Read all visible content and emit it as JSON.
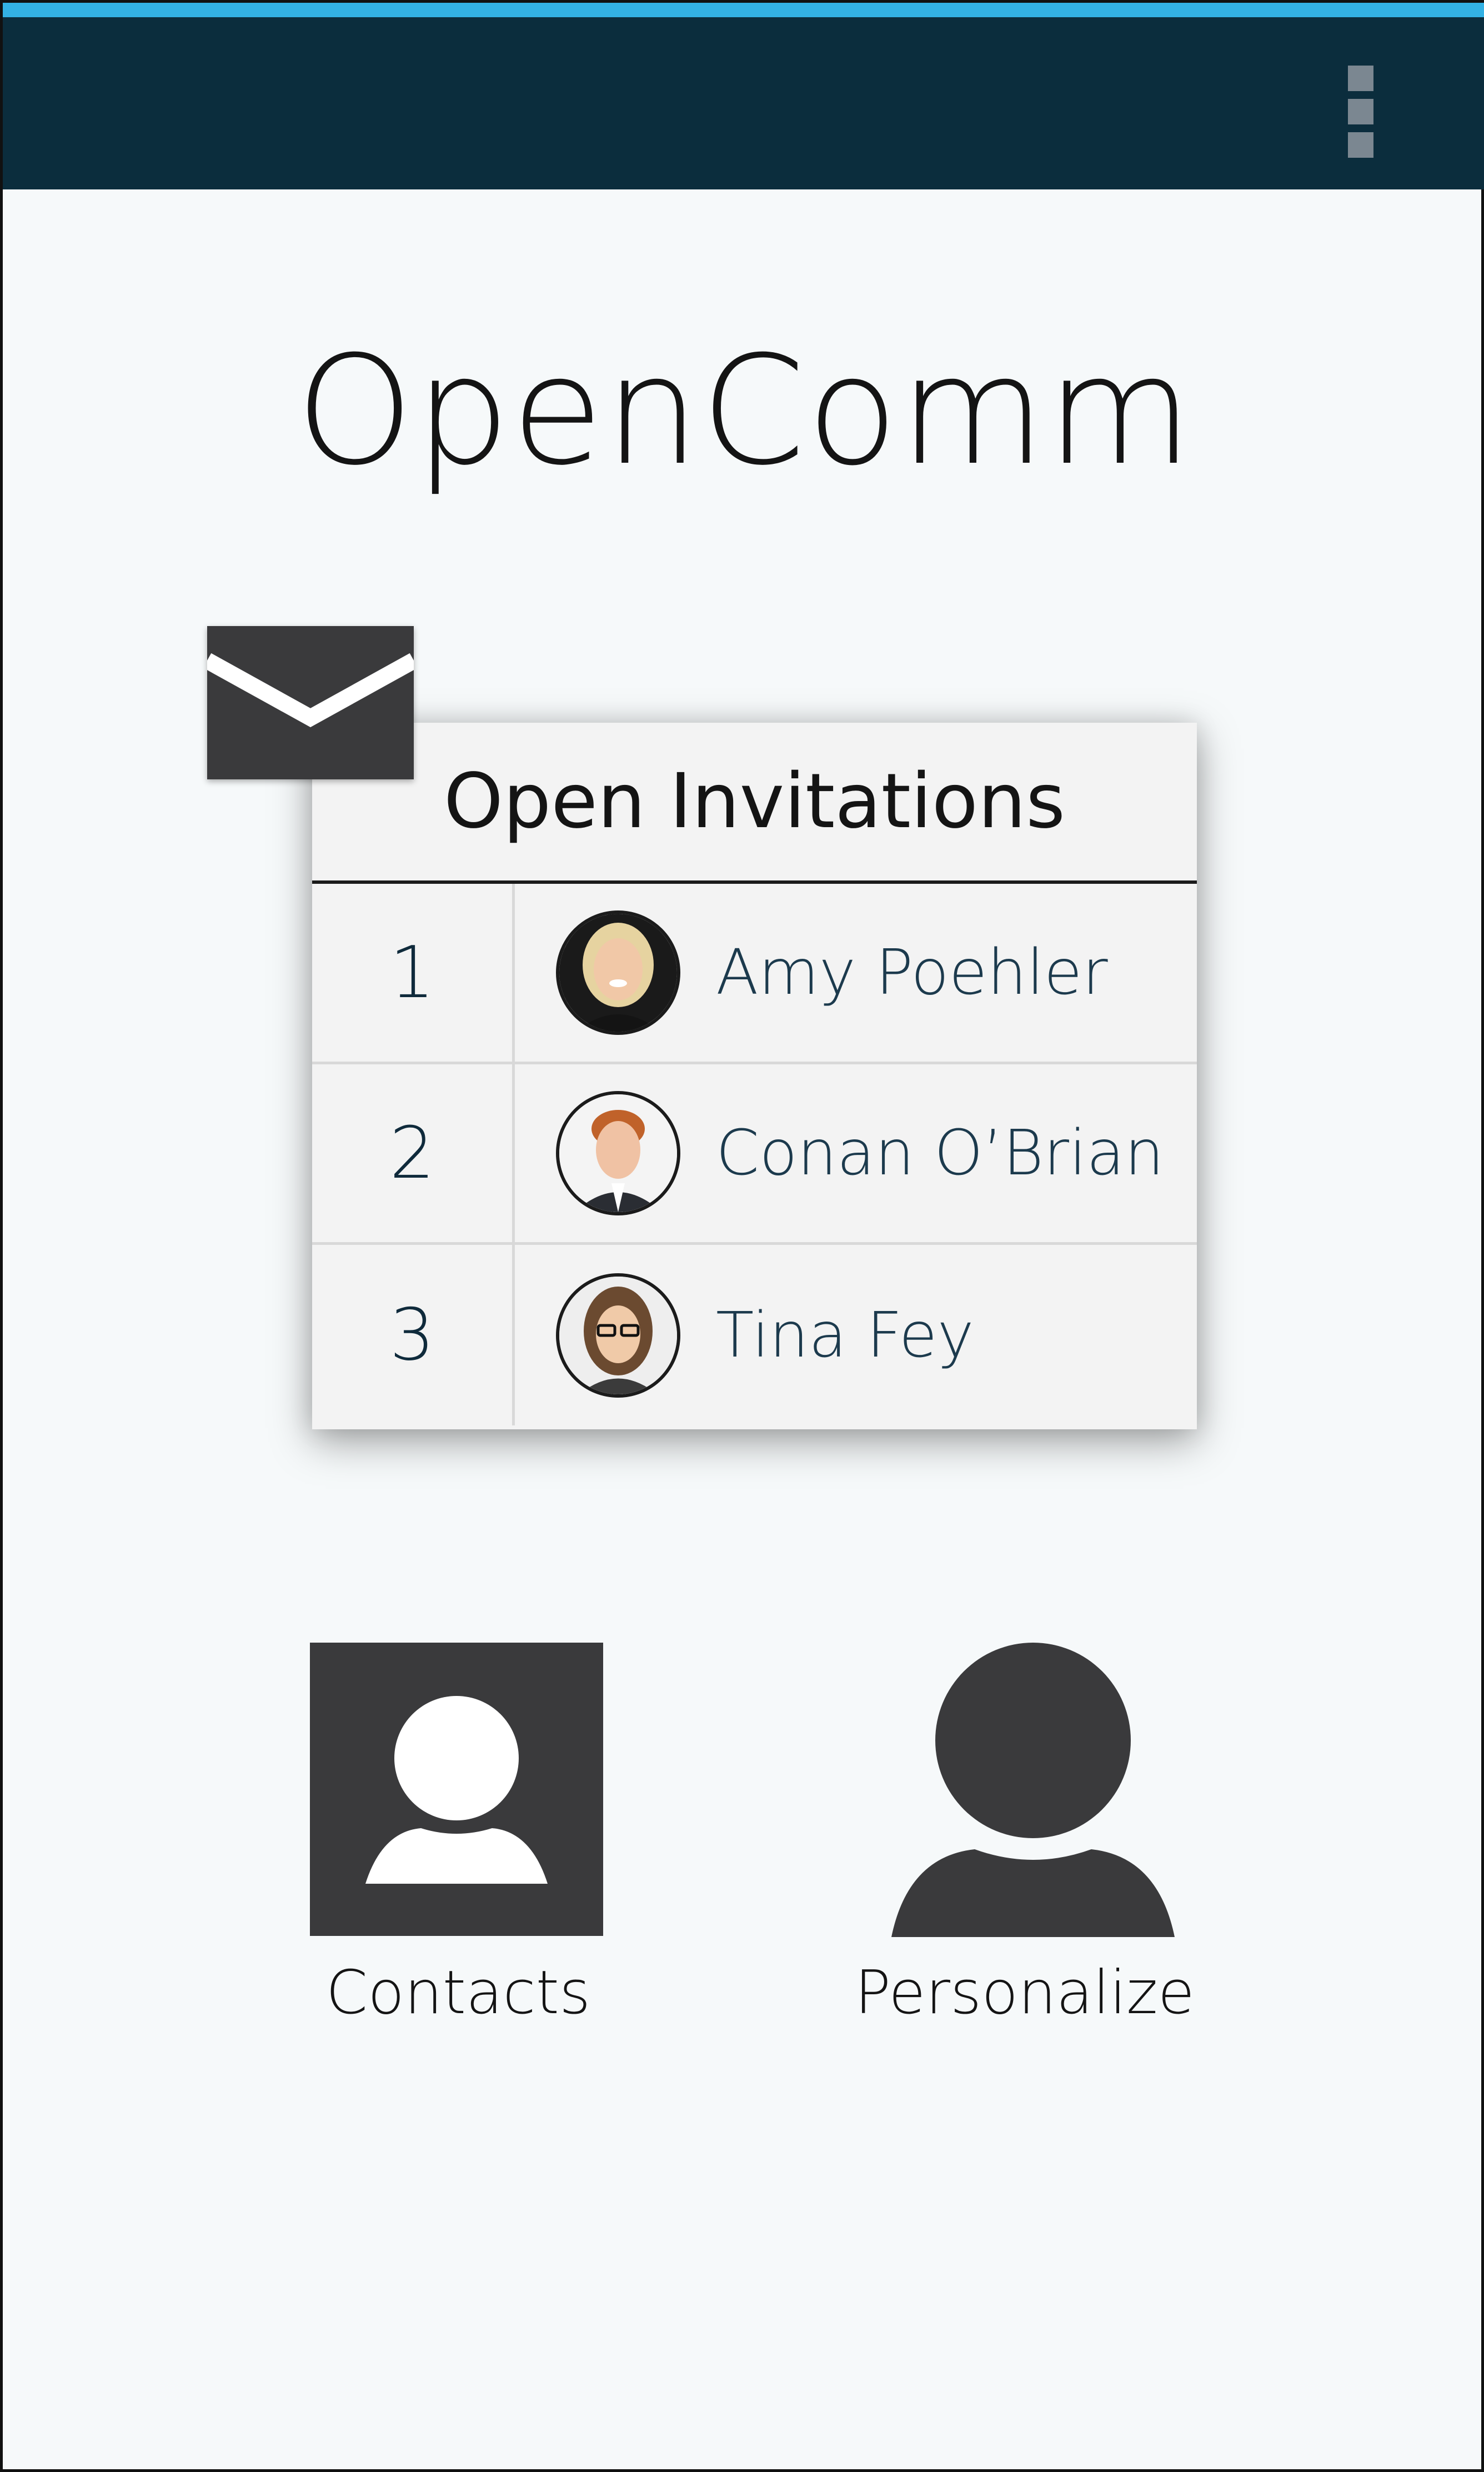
{
  "app": {
    "title": "OpenComm"
  },
  "app_bar": {
    "overflow_icon": "overflow-menu-icon"
  },
  "invitations": {
    "icon": "envelope-icon",
    "title": "Open Invitations",
    "rows": [
      {
        "number": "1",
        "name": "Amy Poehler"
      },
      {
        "number": "2",
        "name": "Conan O’Brian"
      },
      {
        "number": "3",
        "name": "Tina Fey"
      }
    ]
  },
  "actions": {
    "contacts_label": "Contacts",
    "contacts_icon": "contacts-icon",
    "personalize_label": "Personalize",
    "personalize_icon": "person-icon"
  },
  "colors": {
    "accent": "#33b1e4",
    "app_bar": "#0b2d3d",
    "icon_dark": "#3a3a3c",
    "background": "#f6f9fa"
  }
}
